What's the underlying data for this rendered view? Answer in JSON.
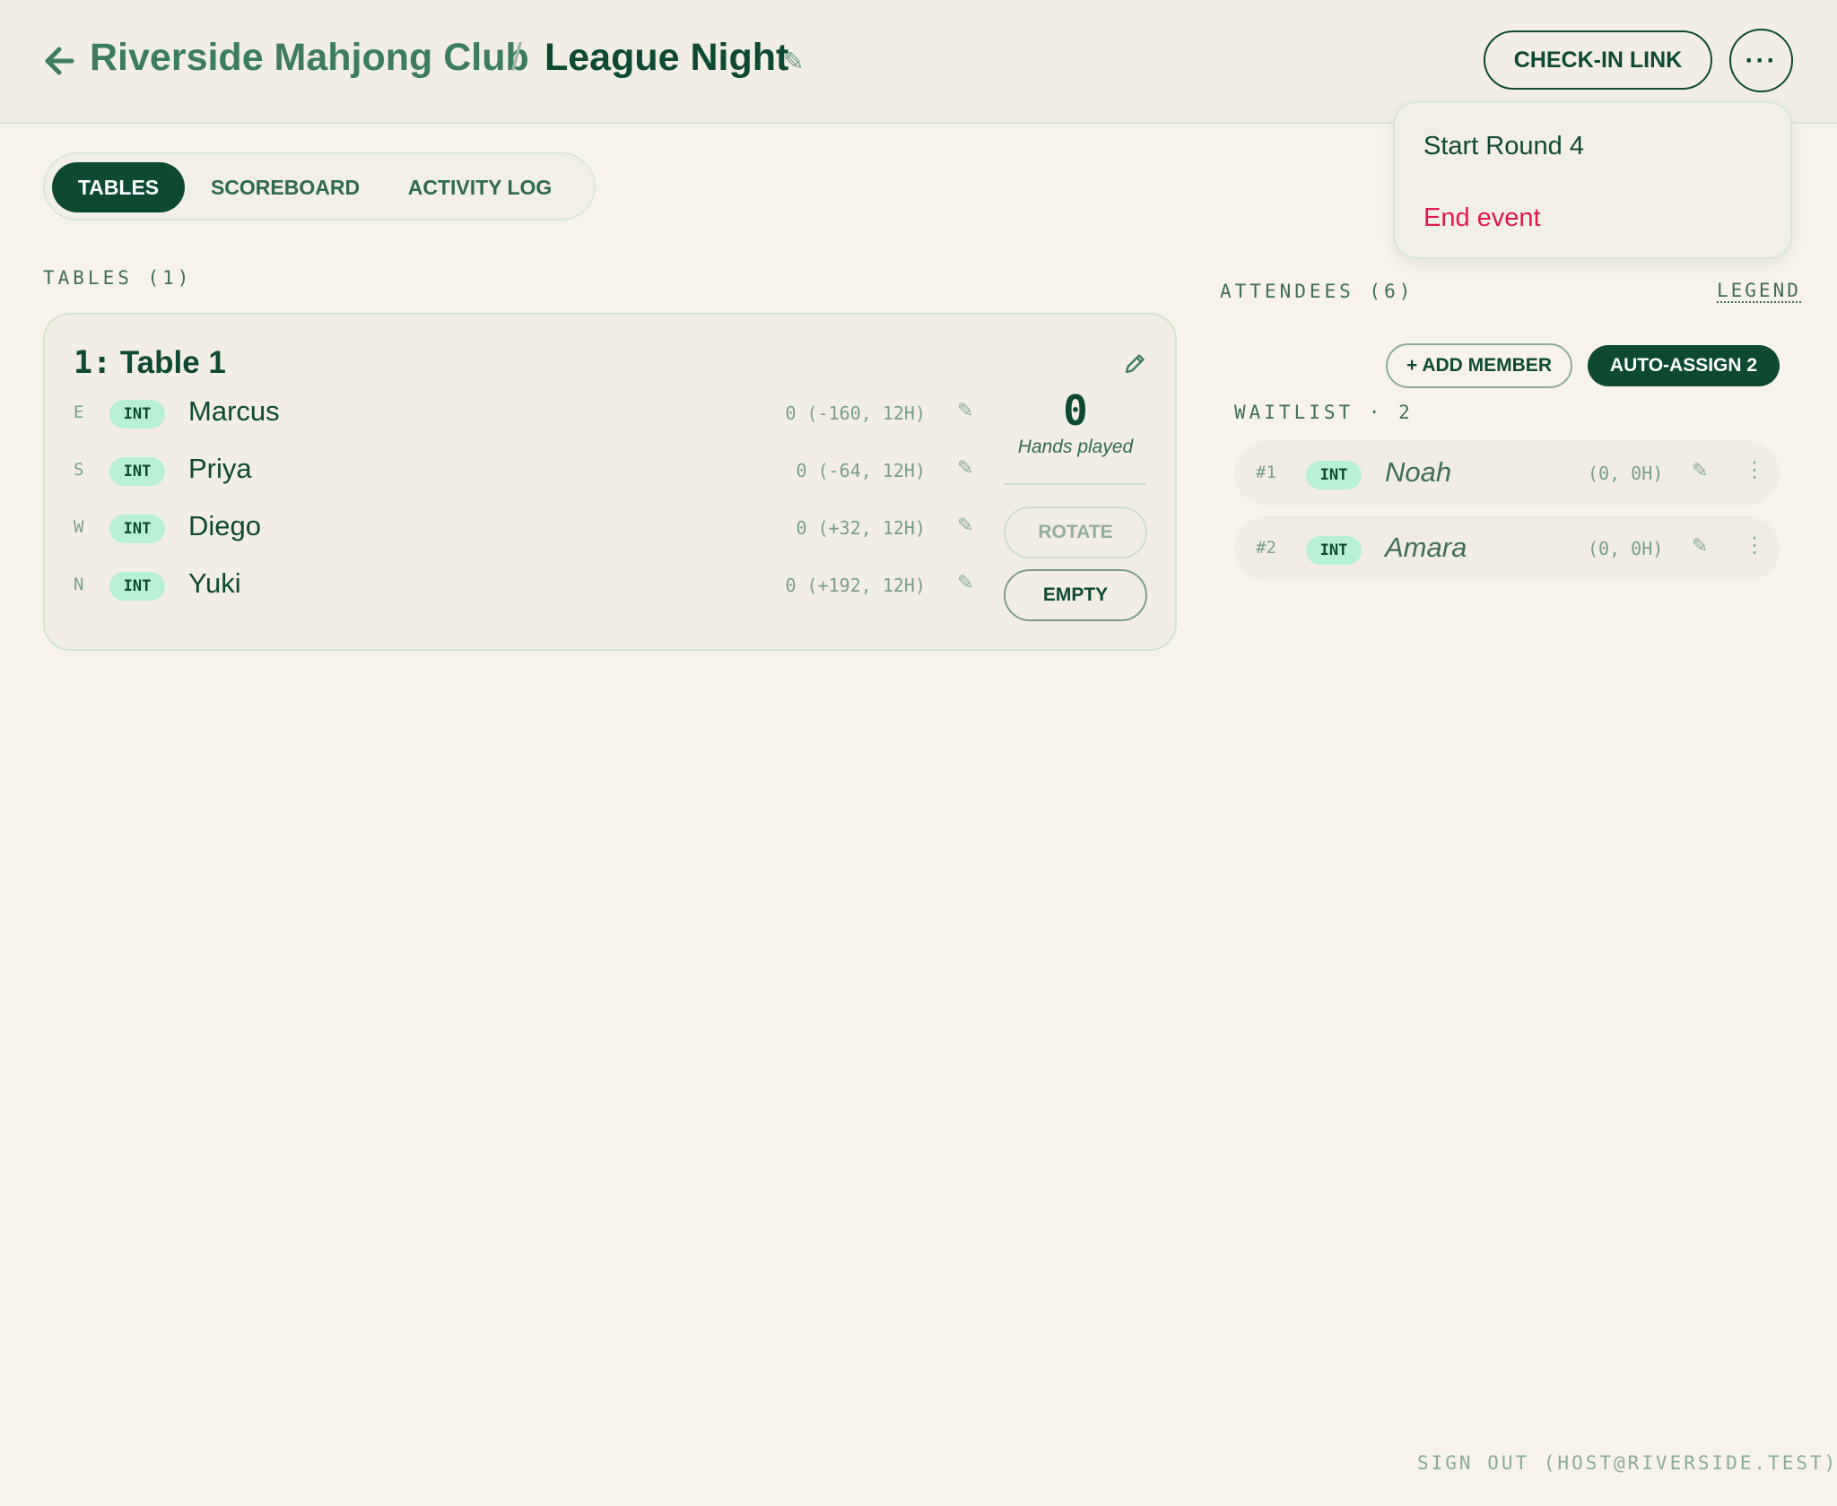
{
  "header": {
    "club_name": "Riverside Mahjong Club",
    "separator": "/",
    "event_name": "League Night",
    "checkin_label": "CHECK-IN LINK",
    "more_label": "···"
  },
  "menu": {
    "items": [
      {
        "label": "Start Round 4",
        "color": "#0f4a33"
      },
      {
        "label": "End event",
        "color": "#df1a4a"
      }
    ]
  },
  "tabs": [
    {
      "label": "TABLES",
      "active": true
    },
    {
      "label": "SCOREBOARD",
      "active": false
    },
    {
      "label": "ACTIVITY LOG",
      "active": false
    }
  ],
  "tables_section": {
    "label": "TABLES (1)",
    "tables": [
      {
        "number": "1:",
        "name": "Table 1",
        "hands_played": "0",
        "hands_label": "Hands played",
        "rotate_label": "ROTATE",
        "empty_label": "EMPTY",
        "seats": [
          {
            "wind": "E",
            "badge": "INT",
            "name": "Marcus",
            "score": "0 (-160, 12H)"
          },
          {
            "wind": "S",
            "badge": "INT",
            "name": "Priya",
            "score": "0 (-64, 12H)"
          },
          {
            "wind": "W",
            "badge": "INT",
            "name": "Diego",
            "score": "0 (+32, 12H)"
          },
          {
            "wind": "N",
            "badge": "INT",
            "name": "Yuki",
            "score": "0 (+192, 12H)"
          }
        ]
      }
    ]
  },
  "attendees": {
    "label": "ATTENDEES (6)",
    "legend_label": "LEGEND",
    "add_member_label": "+ ADD MEMBER",
    "auto_assign_label": "AUTO-ASSIGN 2",
    "waitlist_label": "WAITLIST · 2",
    "waitlist": [
      {
        "rank": "#1",
        "badge": "INT",
        "name": "Noah",
        "score": "(0, 0H)"
      },
      {
        "rank": "#2",
        "badge": "INT",
        "name": "Amara",
        "score": "(0, 0H)"
      }
    ]
  },
  "footer": {
    "signout_label": "SIGN OUT (HOST@RIVERSIDE.TEST)"
  },
  "colors": {
    "brand": "#0d4a31",
    "badge_bg": "#b8f0d2",
    "danger": "#df1a4a",
    "background": "#f7f3ea"
  }
}
